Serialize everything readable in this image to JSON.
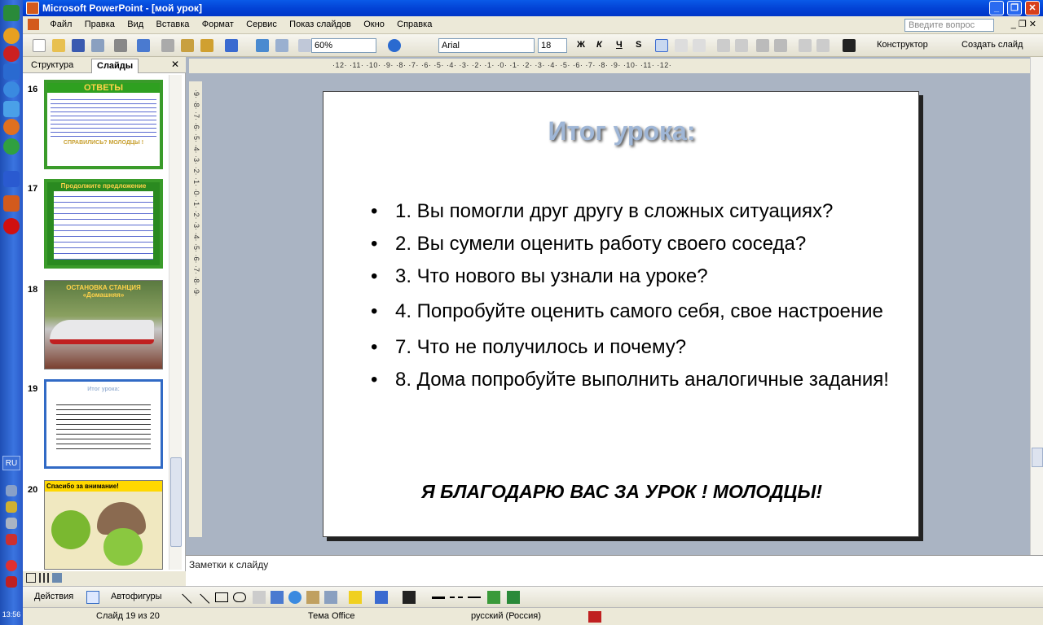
{
  "window": {
    "title": "Microsoft PowerPoint - [мой урок]"
  },
  "menu": {
    "items": [
      "Файл",
      "Правка",
      "Вид",
      "Вставка",
      "Формат",
      "Сервис",
      "Показ слайдов",
      "Окно",
      "Справка"
    ],
    "ask_placeholder": "Введите вопрос"
  },
  "toolbar": {
    "zoom": "60%",
    "font": "Arial",
    "font_size": "18",
    "bold": "Ж",
    "italic": "К",
    "underline": "Ч",
    "shadow": "S",
    "designer": "Конструктор",
    "new_slide": "Создать слайд"
  },
  "ruler": {
    "horizontal": "·12· ·11· ·10· ·9· ·8· ·7· ·6· ·5· ·4· ·3· ·2· ·1· ·0· ·1· ·2· ·3· ·4· ·5· ·6· ·7· ·8· ·9· ·10· ·11· ·12·",
    "vertical": "·9· ·8· ·7· ·6· ·5· ·4· ·3· ·2· ·1· ·0· ·1· ·2· ·3· ·4· ·5· ·6· ·7· ·8· ·9·"
  },
  "left_panel": {
    "tabs": [
      "Структура",
      "Слайды"
    ],
    "close": "✕",
    "thumbnails": [
      {
        "num": "16",
        "title": "ОТВЕТЫ",
        "caption": "СПРАВИЛИСЬ? МОЛОДЦЫ !"
      },
      {
        "num": "17",
        "title": "Продолжите предложение"
      },
      {
        "num": "18",
        "title": "ОСТАНОВКА СТАНЦИЯ «Домашняя»"
      },
      {
        "num": "19",
        "title": "Итог урока:"
      },
      {
        "num": "20",
        "title": "Спасибо за внимание!"
      }
    ]
  },
  "slide": {
    "title": "Итог урока:",
    "bullets": [
      "1.   Вы помогли друг другу в сложных ситуациях?",
      "2.   Вы сумели оценить работу своего соседа?",
      "3.   Что нового вы узнали на уроке?",
      "4.    Попробуйте оценить самого себя, свое настроение",
      "7.    Что не получилось  и почему?",
      "8.    Дома  попробуйте выполнить аналогичные задания!"
    ],
    "footer": "Я БЛАГОДАРЮ ВАС ЗА УРОК !  МОЛОДЦЫ!"
  },
  "notes": {
    "placeholder": "Заметки к слайду"
  },
  "drawbar": {
    "actions": "Действия",
    "autoshapes": "Автофигуры"
  },
  "status": {
    "slide": "Слайд  19 из 20",
    "theme": "Тема Office",
    "language": "русский (Россия)"
  },
  "taskbar": {
    "lang": "RU",
    "clock": "13:56"
  },
  "colors": {
    "title_blue": "#0343d6",
    "slide_title": "#9fb6d6",
    "thumb_green": "#3a9b2a"
  }
}
